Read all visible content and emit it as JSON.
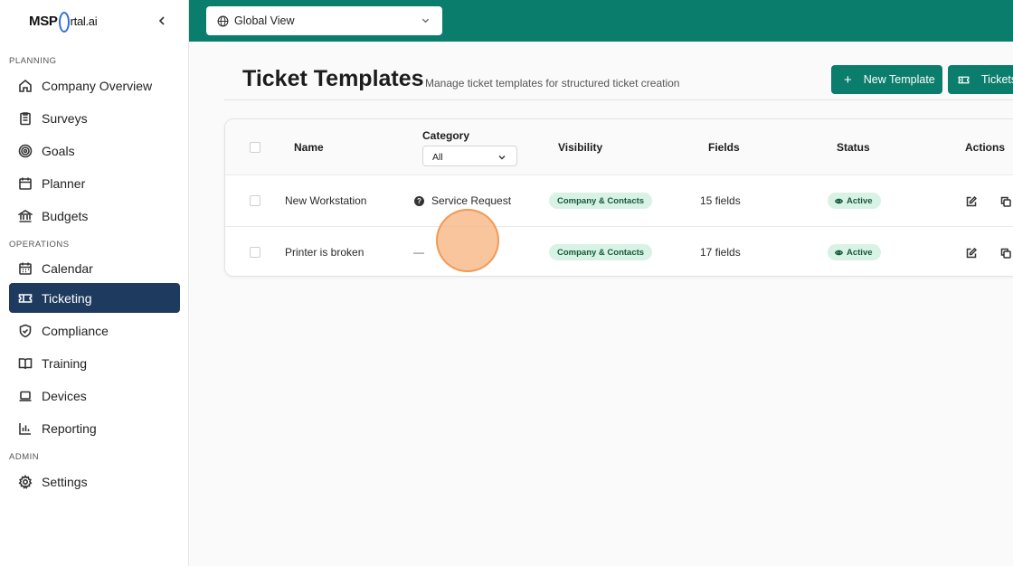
{
  "brand": {
    "logo_prefix": "MSP",
    "logo_suffix": "rtal.ai",
    "accent_color": "#0b7d6c",
    "nav_active_color": "#1e3a5f"
  },
  "sidebar": {
    "sections": [
      {
        "label": "PLANNING",
        "items": [
          {
            "label": "Company Overview",
            "icon": "home-icon"
          },
          {
            "label": "Surveys",
            "icon": "clipboard-icon"
          },
          {
            "label": "Goals",
            "icon": "target-icon"
          },
          {
            "label": "Planner",
            "icon": "calendar-icon"
          },
          {
            "label": "Budgets",
            "icon": "bank-icon"
          }
        ]
      },
      {
        "label": "OPERATIONS",
        "items": [
          {
            "label": "Calendar",
            "icon": "calendar-grid-icon"
          },
          {
            "label": "Ticketing",
            "icon": "ticket-icon",
            "active": true
          },
          {
            "label": "Compliance",
            "icon": "shield-icon"
          },
          {
            "label": "Training",
            "icon": "book-icon"
          },
          {
            "label": "Devices",
            "icon": "laptop-icon"
          },
          {
            "label": "Reporting",
            "icon": "bar-chart-icon"
          }
        ]
      },
      {
        "label": "ADMIN",
        "items": [
          {
            "label": "Settings",
            "icon": "gear-icon"
          }
        ]
      }
    ]
  },
  "topbar": {
    "view_select": "Global View"
  },
  "page": {
    "title": "Ticket Templates",
    "subtitle": "Manage ticket templates for structured ticket creation",
    "new_template_label": "New Template",
    "tickets_label": "Tickets"
  },
  "table": {
    "headers": {
      "name": "Name",
      "category": "Category",
      "category_filter": "All",
      "visibility": "Visibility",
      "fields": "Fields",
      "status": "Status",
      "actions": "Actions"
    },
    "rows": [
      {
        "name": "New Workstation",
        "category": "Service Request",
        "visibility": "Company & Contacts",
        "fields": "15 fields",
        "status": "Active"
      },
      {
        "name": "Printer is broken",
        "category": "—",
        "visibility": "Company & Contacts",
        "fields": "17 fields",
        "status": "Active"
      }
    ]
  }
}
